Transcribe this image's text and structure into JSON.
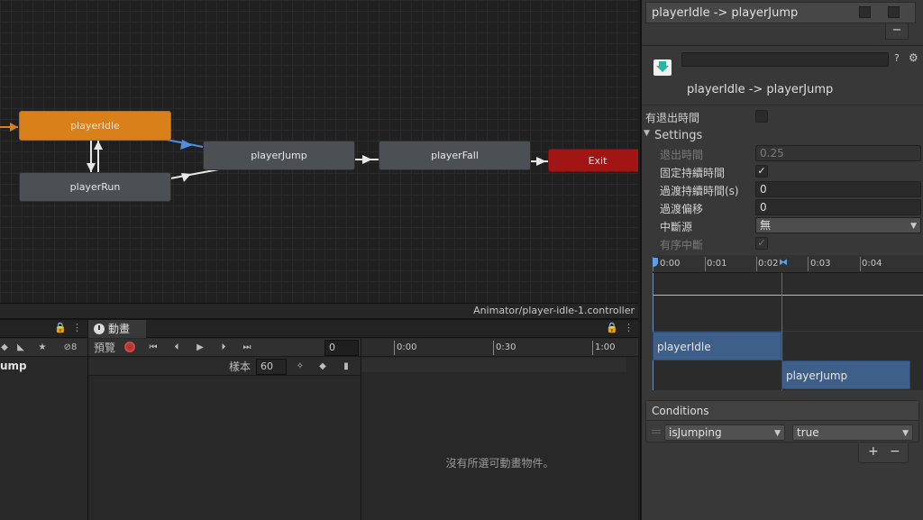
{
  "graph": {
    "states": {
      "idle": "playerIdle",
      "run": "playerRun",
      "jump": "playerJump",
      "fall": "playerFall",
      "exit": "Exit"
    },
    "footer_path": "Animator/player-idle-1.controller"
  },
  "hierarchy_panel": {
    "layer_count": "8",
    "selected_item": "ump"
  },
  "animation": {
    "tab_label": "動畫",
    "preview_label": "預覽",
    "frame_value": "0",
    "samples_label": "樣本",
    "samples_value": "60",
    "timeline_ticks": [
      "0:00",
      "0:30",
      "1:00"
    ],
    "empty_message": "沒有所選可動畫物件。"
  },
  "inspector": {
    "transition_list_item": "playerIdle -> playerJump",
    "transition_title": "playerIdle -> playerJump",
    "name_field_value": "",
    "has_exit_time_label": "有退出時間",
    "settings_label": "Settings",
    "exit_time_label": "退出時間",
    "exit_time_value": "0.25",
    "fixed_duration_label": "固定持續時間",
    "transition_duration_label": "過渡持續時間(s)",
    "transition_duration_value": "0",
    "transition_offset_label": "過渡偏移",
    "transition_offset_value": "0",
    "interruption_source_label": "中斷源",
    "interruption_source_value": "無",
    "ordered_interruption_label": "有序中斷",
    "minus_label": "−",
    "timeline_ticks": [
      "0:00",
      "0:01",
      "0:02",
      "0:03",
      "0:04"
    ],
    "timeline_bars": {
      "source": "playerIdle",
      "target": "playerJump"
    },
    "conditions": {
      "title": "Conditions",
      "parameter": "isJumping",
      "value": "true"
    },
    "add_label": "+",
    "remove_label": "−"
  }
}
